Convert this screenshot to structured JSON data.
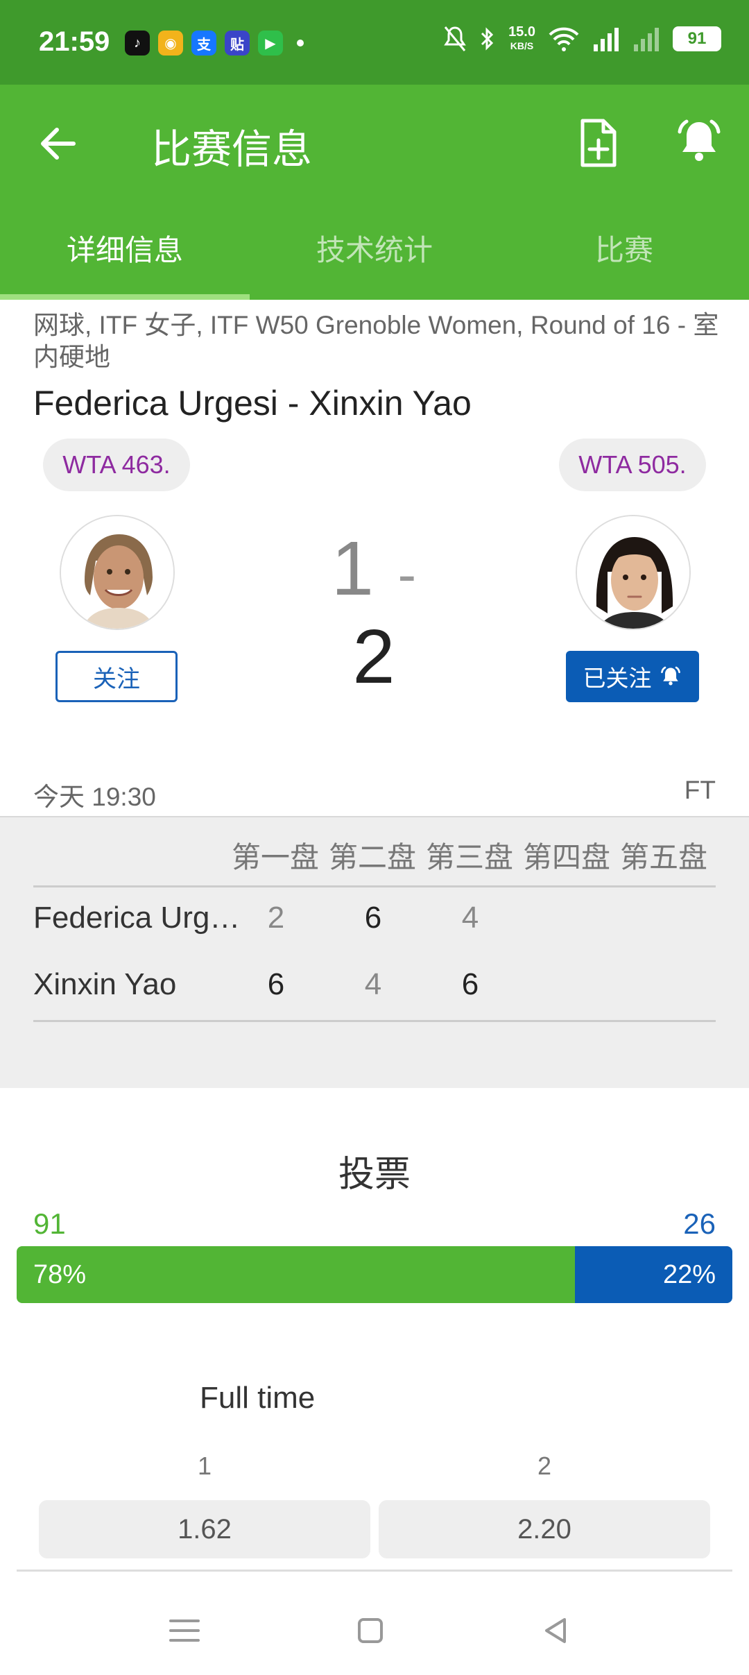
{
  "status_bar": {
    "time": "21:59",
    "net_speed": "15.0",
    "net_unit": "KB/S",
    "battery": "91",
    "apps": [
      {
        "icon": "tiktok-icon",
        "color": "#111111",
        "glyph": "♪"
      },
      {
        "icon": "weibo-icon",
        "color": "#f2b31b",
        "glyph": "◉"
      },
      {
        "icon": "alipay-icon",
        "color": "#1677ff",
        "glyph": "支"
      },
      {
        "icon": "tieba-icon",
        "color": "#3a45c8",
        "glyph": "贴"
      },
      {
        "icon": "video-app-icon",
        "color": "#2fbf4a",
        "glyph": "▶"
      }
    ]
  },
  "app_bar": {
    "title": "比赛信息"
  },
  "tabs": [
    {
      "label": "详细信息",
      "active": true
    },
    {
      "label": "技术统计",
      "active": false
    },
    {
      "label": "比赛",
      "active": false
    }
  ],
  "match": {
    "breadcrumb": "网球, ITF 女子, ITF W50 Grenoble Women, Round of 16 - 室内硬地",
    "title": "Federica Urgesi - Xinxin Yao",
    "home_rank": "WTA 463.",
    "away_rank": "WTA 505.",
    "home_score": "1",
    "score_sep": "-",
    "away_score": "2",
    "follow_label": "关注",
    "followed_label": "已关注",
    "start_time": "今天 19:30",
    "status": "FT"
  },
  "sets": {
    "headers": [
      "第一盘",
      "第二盘",
      "第三盘",
      "第四盘",
      "第五盘"
    ],
    "players": [
      {
        "name": "Federica Urg…",
        "scores": [
          "2",
          "6",
          "4"
        ],
        "won": [
          false,
          true,
          false
        ]
      },
      {
        "name": "Xinxin Yao",
        "scores": [
          "6",
          "4",
          "6"
        ],
        "won": [
          true,
          false,
          true
        ]
      }
    ]
  },
  "vote": {
    "title": "投票",
    "home_count": "91",
    "away_count": "26",
    "home_pct": "78%",
    "away_pct": "22%",
    "home_share": 0.78
  },
  "odds": {
    "title": "Full time",
    "labels": [
      "1",
      "2"
    ],
    "values": [
      "1.62",
      "2.20"
    ]
  },
  "colors": {
    "brand_green": "#52b535",
    "status_green": "#3f9a2c",
    "accent_blue": "#0b5cb5",
    "rank_purple": "#8e2aa0"
  }
}
